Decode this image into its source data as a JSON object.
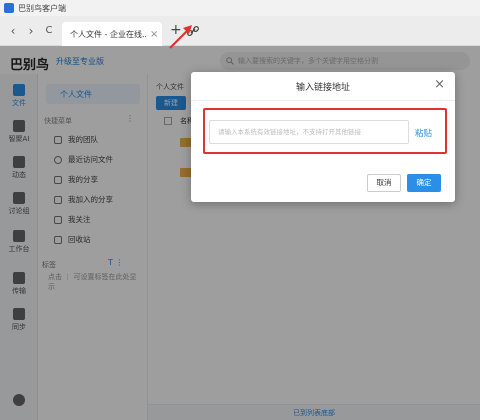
{
  "window": {
    "title": "巴别鸟客户端"
  },
  "browser": {
    "back_icon": "‹",
    "forward_icon": "›",
    "reload_icon": "C",
    "tab_label": "个人文件 - 企业在线...",
    "tab_close": "×",
    "new_tab": "+"
  },
  "header": {
    "brand": "巴别鸟",
    "upgrade": "升级至专业版",
    "search_placeholder": "输入要搜索的关键字，多个关键字用空格分割"
  },
  "rail": {
    "items": [
      {
        "label": "文件",
        "active": true
      },
      {
        "label": "智聚AI"
      },
      {
        "label": "动态"
      },
      {
        "label": "讨论组"
      },
      {
        "label": "工作台"
      },
      {
        "label": "传输"
      },
      {
        "label": "同步"
      }
    ]
  },
  "sidebar": {
    "my_files": "个人文件",
    "quick_menu": "快捷菜单",
    "more": "⋮",
    "items": [
      {
        "label": "我的团队"
      },
      {
        "label": "最近访问文件"
      },
      {
        "label": "我的分享"
      },
      {
        "label": "我加入的分享"
      },
      {
        "label": "我关注"
      },
      {
        "label": "回收站"
      }
    ],
    "tags_label": "标签",
    "tags_tools": "T ⋮",
    "tags_hint": "点击 ⋮ 可设置标签在此处显示"
  },
  "main": {
    "breadcrumb": "个人文件",
    "new_button": "新建",
    "col_name": "名称",
    "footer": "已到列表底部"
  },
  "dialog": {
    "title": "输入链接地址",
    "close": "×",
    "placeholder": "请输入本系统有效链接地址，不支持打开其他链接",
    "paste": "粘贴",
    "cancel": "取消",
    "confirm": "确定"
  },
  "colors": {
    "accent": "#2b8fe8",
    "highlight": "#e0332e",
    "folder": "#f4b04a"
  }
}
